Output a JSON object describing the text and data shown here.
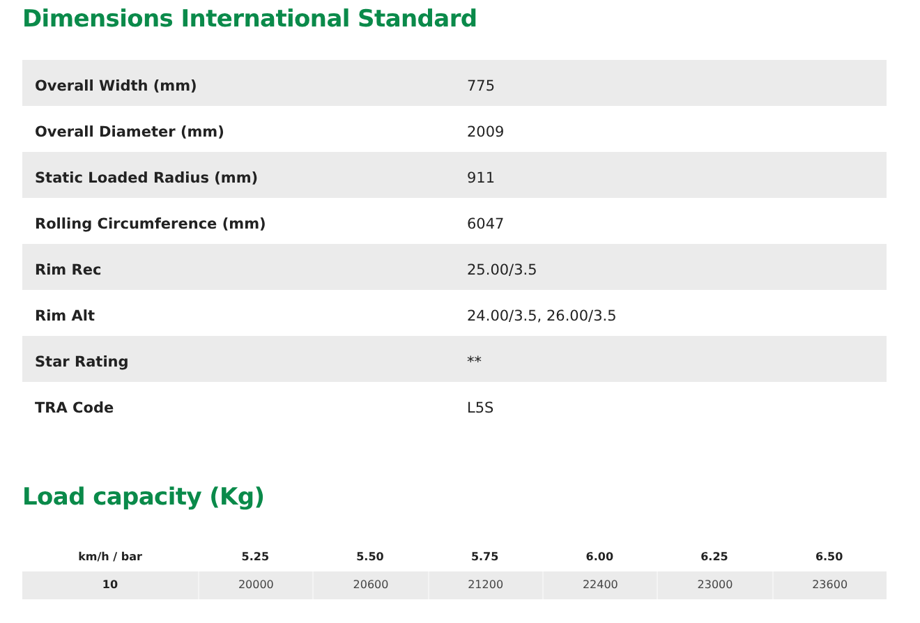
{
  "dimensions": {
    "title": "Dimensions International Standard",
    "rows": [
      {
        "label": "Overall Width (mm)",
        "value": "775"
      },
      {
        "label": "Overall Diameter (mm)",
        "value": "2009"
      },
      {
        "label": "Static Loaded Radius (mm)",
        "value": "911"
      },
      {
        "label": "Rolling Circumference (mm)",
        "value": "6047"
      },
      {
        "label": "Rim Rec",
        "value": "25.00/3.5"
      },
      {
        "label": "Rim Alt",
        "value": "24.00/3.5, 26.00/3.5"
      },
      {
        "label": "Star Rating",
        "value": "**"
      },
      {
        "label": "TRA Code",
        "value": "L5S"
      }
    ]
  },
  "load_capacity": {
    "title": "Load capacity (Kg)",
    "columns": [
      "km/h / bar",
      "5.25",
      "5.50",
      "5.75",
      "6.00",
      "6.25",
      "6.50"
    ],
    "rows": [
      {
        "speed": "10",
        "values": [
          "20000",
          "20600",
          "21200",
          "22400",
          "23000",
          "23600"
        ]
      }
    ]
  }
}
